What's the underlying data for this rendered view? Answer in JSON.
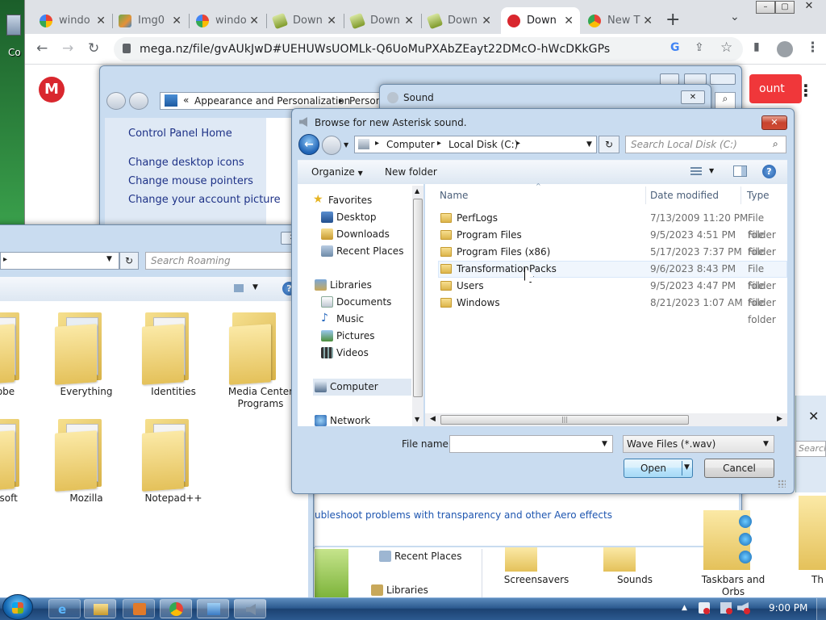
{
  "desktop": {
    "icon_label": "Co"
  },
  "browser": {
    "tabs": [
      {
        "title": "windo",
        "icon": "google-icon"
      },
      {
        "title": "Img0",
        "icon": "image-icon"
      },
      {
        "title": "windo",
        "icon": "google-icon"
      },
      {
        "title": "Down",
        "icon": "download-icon"
      },
      {
        "title": "Down",
        "icon": "download-icon"
      },
      {
        "title": "Down",
        "icon": "download-icon"
      },
      {
        "title": "Down",
        "icon": "mega-icon"
      },
      {
        "title": "New T",
        "icon": "chrome-icon"
      }
    ],
    "url": "mega.nz/file/gvAUkJwD#UEHUWsUOMLk-Q6UoMuPXAbZEayt22DMcO-hWcDKkGPs",
    "new_tab_symbol": "+",
    "mega": {
      "logo": "M",
      "button_label": "ount"
    }
  },
  "control_panel": {
    "address": [
      "Appearance and Personalization",
      "Person"
    ],
    "nav": [
      "Control Panel Home",
      "Change desktop icons",
      "Change mouse pointers",
      "Change your account picture"
    ],
    "bottom_link": "ubleshoot problems with transparency and other Aero effects",
    "bottom_nav": [
      "Recent Places",
      "Libraries"
    ],
    "themes": [
      "Screensavers",
      "Sounds",
      "Taskbars and Orbs",
      "Th"
    ]
  },
  "sound_window": {
    "title": "Sound"
  },
  "roaming_window": {
    "search_placeholder": "Search Roaming",
    "folders": [
      {
        "label": "obe"
      },
      {
        "label": "Everything"
      },
      {
        "label": "Identities"
      },
      {
        "label": "Media Center Programs"
      },
      {
        "label": "osoft"
      },
      {
        "label": "Mozilla"
      },
      {
        "label": "Notepad++"
      }
    ]
  },
  "right_partial": {
    "search_placeholder": "Search"
  },
  "dialog": {
    "title": "Browse for new Asterisk sound.",
    "breadcrumb": [
      "Computer",
      "Local Disk (C:)"
    ],
    "search_placeholder": "Search Local Disk (C:)",
    "organize_label": "Organize",
    "new_folder_label": "New folder",
    "nav": {
      "favorites": "Favorites",
      "favorites_items": [
        "Desktop",
        "Downloads",
        "Recent Places"
      ],
      "libraries": "Libraries",
      "libraries_items": [
        "Documents",
        "Music",
        "Pictures",
        "Videos"
      ],
      "computer": "Computer",
      "network": "Network"
    },
    "columns": {
      "name": "Name",
      "date": "Date modified",
      "type": "Type"
    },
    "files": [
      {
        "name": "PerfLogs",
        "date": "7/13/2009 11:20 PM",
        "type": "File folder"
      },
      {
        "name": "Program Files",
        "date": "9/5/2023 4:51 PM",
        "type": "File folder"
      },
      {
        "name": "Program Files (x86)",
        "date": "5/17/2023 7:37 PM",
        "type": "File folder"
      },
      {
        "name": "TransformationPacks",
        "date": "9/6/2023 8:43 PM",
        "type": "File folder"
      },
      {
        "name": "Users",
        "date": "9/5/2023 4:47 PM",
        "type": "File folder"
      },
      {
        "name": "Windows",
        "date": "8/21/2023 1:07 AM",
        "type": "File folder"
      }
    ],
    "file_name_label": "File name:",
    "file_name_value": "",
    "filter": "Wave Files (*.wav)",
    "open_label": "Open",
    "cancel_label": "Cancel"
  },
  "taskbar": {
    "clock": "9:00 PM"
  },
  "colors": {
    "mega_red": "#d9272e",
    "aero_blue": "#c9dcf0",
    "taskbar": "#2b5a8f"
  }
}
